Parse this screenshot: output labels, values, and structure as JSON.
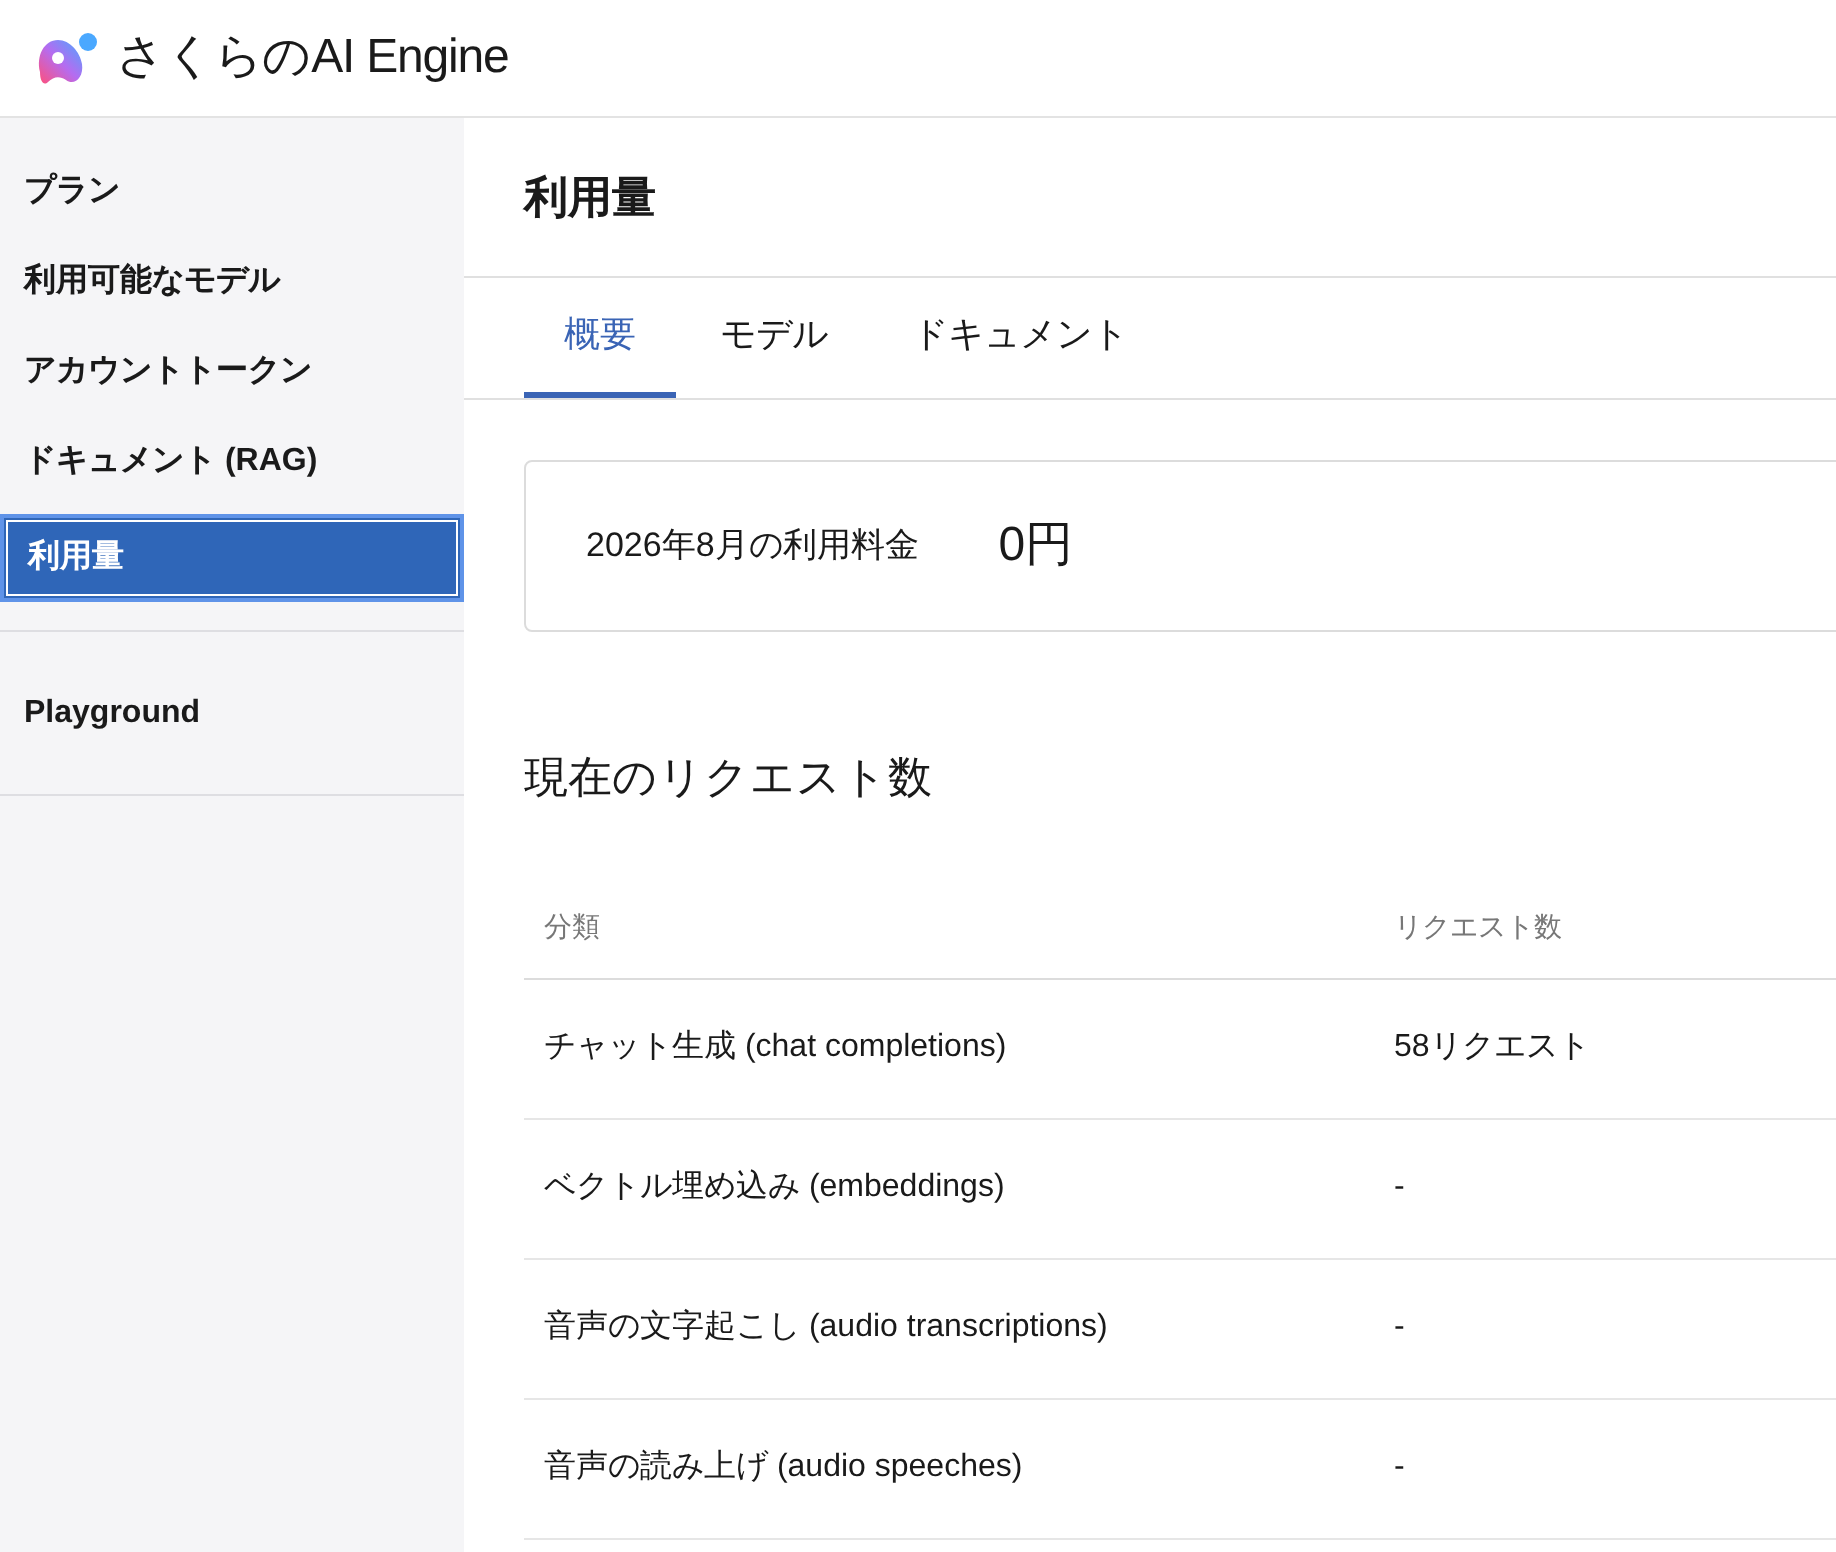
{
  "header": {
    "brand": "さくらのAI Engine"
  },
  "sidebar": {
    "groups": [
      [
        {
          "label": "プラン",
          "selected": false
        },
        {
          "label": "利用可能なモデル",
          "selected": false
        },
        {
          "label": "アカウントトークン",
          "selected": false
        },
        {
          "label": "ドキュメント (RAG)",
          "selected": false
        },
        {
          "label": "利用量",
          "selected": true
        }
      ],
      [
        {
          "label": "Playground",
          "selected": false
        }
      ]
    ]
  },
  "page": {
    "title": "利用量",
    "tabs": [
      {
        "label": "概要",
        "selected": true
      },
      {
        "label": "モデル",
        "selected": false
      },
      {
        "label": "ドキュメント",
        "selected": false
      }
    ],
    "billing": {
      "label": "2026年8月の利用料金",
      "amount": "0円"
    },
    "section_title": "現在のリクエスト数",
    "table": {
      "columns": [
        "分類",
        "リクエスト数"
      ],
      "rows": [
        [
          "チャット生成 (chat completions)",
          "58リクエスト"
        ],
        [
          "ベクトル埋め込み (embeddings)",
          "-"
        ],
        [
          "音声の文字起こし (audio transcriptions)",
          "-"
        ],
        [
          "音声の読み上げ (audio speeches)",
          "-"
        ]
      ]
    }
  }
}
